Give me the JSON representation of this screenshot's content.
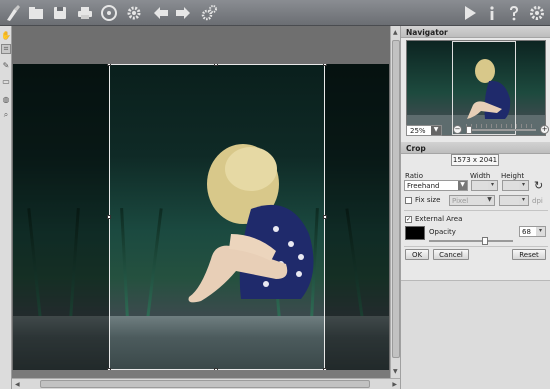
{
  "toolbar": {
    "icons": [
      "brush-logo-icon",
      "open-icon",
      "save-icon",
      "print-icon",
      "share-icon",
      "settings-gear-icon",
      "undo-icon",
      "redo-icon",
      "batch-gear-icon",
      "play-icon",
      "info-icon",
      "help-icon",
      "preferences-icon"
    ]
  },
  "tools": [
    "hand-tool-icon",
    "crop-tool-icon",
    "brush-tool-icon",
    "eraser-tool-icon",
    "stamp-tool-icon",
    "zoom-tool-icon"
  ],
  "navigator": {
    "title": "Navigator",
    "zoom_value": "25%",
    "zoom_minus": "−",
    "zoom_plus": "+",
    "zoom_level": 0.0
  },
  "crop": {
    "title": "Crop",
    "dimensions": "1573 x 2041",
    "ratio_label": "Ratio",
    "ratio_value": "Freehand",
    "width_label": "Width",
    "height_label": "Height",
    "fix_size_label": "Fix size",
    "fix_size_checked": false,
    "unit_value": "Pixel",
    "dpi_label": "dpi",
    "external_area_label": "External Area",
    "external_area_checked": true,
    "opacity_label": "Opacity",
    "opacity_value": "68",
    "area_color": "#000000",
    "ok_label": "OK",
    "cancel_label": "Cancel",
    "reset_label": "Reset"
  },
  "colors": {
    "toolbar": "#7a7d82",
    "panel": "#e8e8e8",
    "canvas": "#6f6f6f"
  }
}
